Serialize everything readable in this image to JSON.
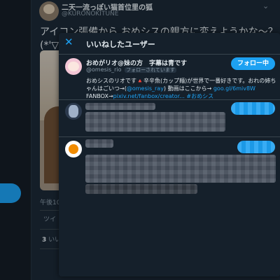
{
  "tweet": {
    "author_name": "二天一流っぽい猫首位里の狐",
    "author_handle": "@KURONOKITUNE",
    "text_line1": "アイコン張備から おめシスの親方に変えようかな～？",
    "text_line2": "(*'▽'",
    "time": "午後10:",
    "stat_label": "ツイ",
    "likes_count": "3",
    "likes_label": " いいね"
  },
  "modal": {
    "title": "いいねしたユーザー",
    "close_icon": "close-icon",
    "users": [
      {
        "name": "おめがリオ@妹の方　字幕は青です",
        "handle": "@omesis_rio",
        "follows_you": "フォローされています",
        "follow_label": "フォロー中",
        "bio_text1": "おめシスのリオです🔺辛辛魚(カップ麺)が世界で一番好きです。おれの姉ちゃんはごいつ→(",
        "bio_mention": "@omesis_ray",
        "bio_text2": ") 動画はここから→ ",
        "bio_link1": "goo.gl/6miv8W",
        "bio_text3": "FANBOX→",
        "bio_link2": "pixiv.net/fanbox/creator...",
        "bio_hashtag": " #おめシス"
      }
    ]
  },
  "colors": {
    "accent": "#1da1f2",
    "background": "#15202b"
  }
}
